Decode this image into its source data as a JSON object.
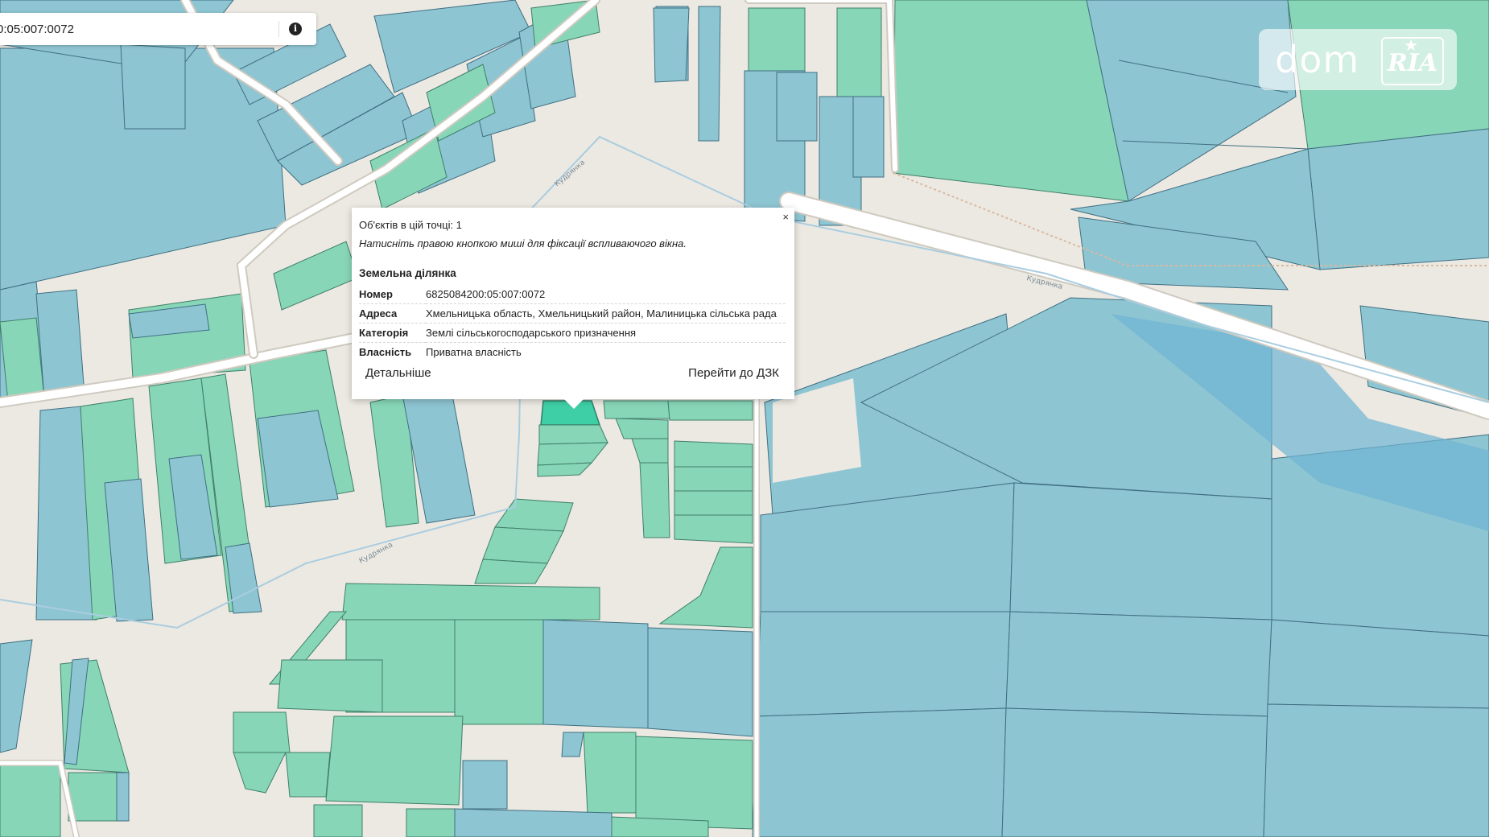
{
  "search": {
    "value": "0:05:007:0072"
  },
  "info_button": {
    "glyph": "i"
  },
  "logo": {
    "dom": "dom",
    "ria": "RIA"
  },
  "map": {
    "street_labels": [
      "Кудрянка",
      "Кудрянка",
      "Кудрянка"
    ],
    "colors": {
      "parcel_blue": "#8ec5d2",
      "parcel_green": "#88d6b8",
      "selected_parcel": "#3fcfa6",
      "background": "#ece9e2",
      "water": "#6fb3d3"
    }
  },
  "popup": {
    "close": "×",
    "objects_line": "Об'єктів в цій точці: 1",
    "hint": "Натисніть правою кнопкою миші для фіксації вспливаючого вікна.",
    "section_title": "Земельна ділянка",
    "rows": [
      {
        "key": "Номер",
        "value": "6825084200:05:007:0072"
      },
      {
        "key": "Адреса",
        "value": "Хмельницька область, Хмельницький район, Малиницька сільська рада"
      },
      {
        "key": "Категорія",
        "value": "Землі сільськогосподарського призначення"
      },
      {
        "key": "Власність",
        "value": "Приватна власність"
      }
    ],
    "details_button": "Детальніше",
    "dzk_button": "Перейти до ДЗК"
  }
}
